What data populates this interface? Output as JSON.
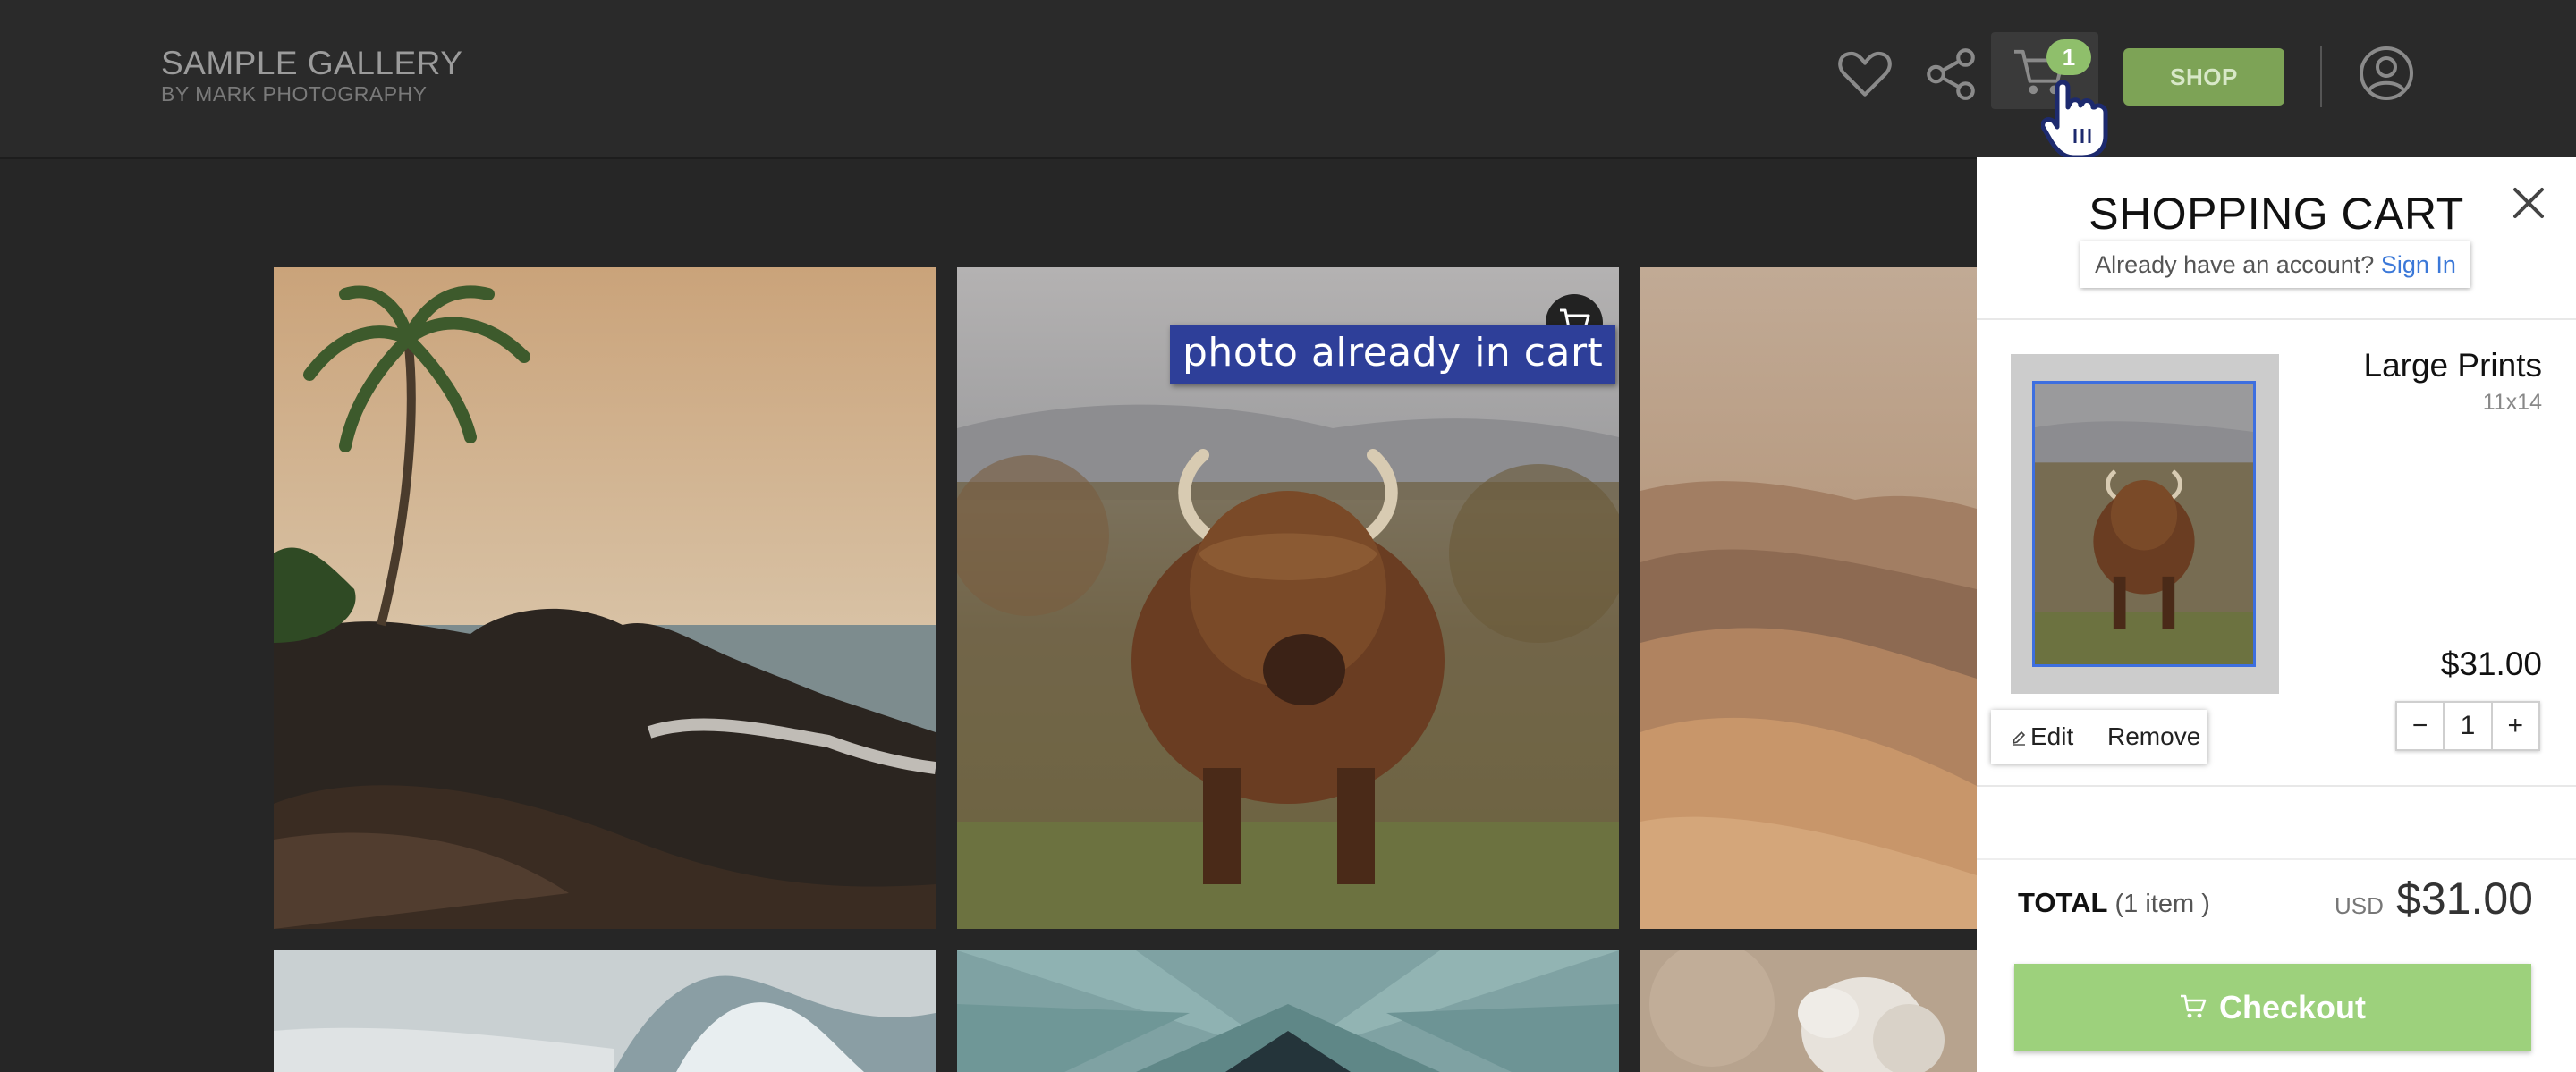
{
  "header": {
    "brand_title": "SAMPLE GALLERY",
    "brand_subtitle": "BY MARK PHOTOGRAPHY",
    "cart_count": "1",
    "shop_label": "SHOP",
    "icons": [
      "heart-icon",
      "share-icon",
      "cart-icon",
      "account-icon"
    ]
  },
  "gallery": {
    "tooltip": "photo already in cart",
    "photos": [
      "beach-palm-photo",
      "highland-cow-photo",
      "desert-dunes-photo",
      "snowy-mountain-photo",
      "succulent-photo",
      "white-animal-photo"
    ]
  },
  "cart": {
    "title": "SHOPPING CART",
    "signin_prompt": "Already have an account?",
    "signin_link": "Sign In",
    "item": {
      "name": "Large Prints",
      "size": "11x14",
      "price": "$31.00",
      "quantity": "1",
      "decrement": "−",
      "increment": "+",
      "edit_label": "Edit",
      "remove_label": "Remove"
    },
    "total_label": "TOTAL",
    "total_count": "(1 item )",
    "currency": "USD",
    "total_amount": "$31.00",
    "checkout_label": "Checkout"
  },
  "colors": {
    "accent_green": "#7da356",
    "checkout_green": "#9dd17c",
    "link_blue": "#3b78d8",
    "tooltip_blue": "#2e3f99"
  }
}
